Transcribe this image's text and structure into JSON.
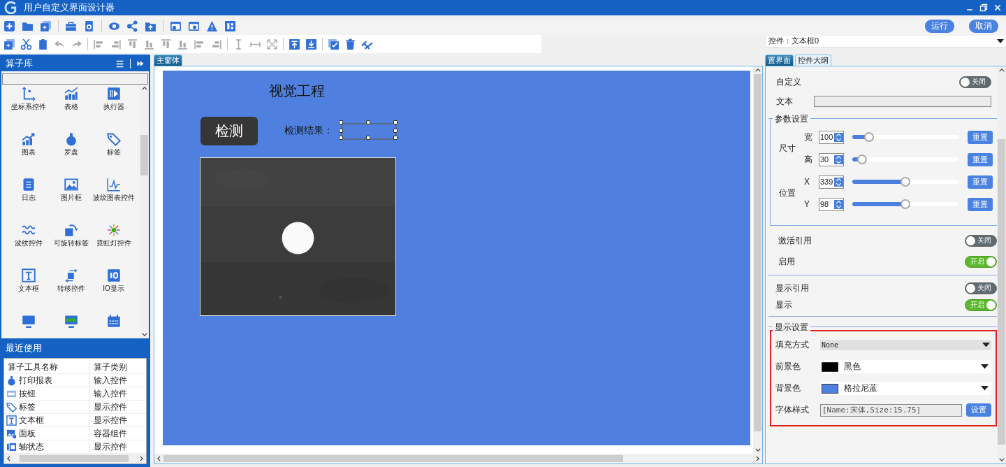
{
  "window": {
    "title": "用户自定义界面设计器"
  },
  "toolbar_main": [
    {
      "disabled": false
    },
    {
      "disabled": false
    },
    {
      "disabled": false
    },
    {
      "disabled": false
    },
    {
      "disabled": false
    },
    {
      "disabled": false
    },
    {
      "disabled": false
    },
    {
      "disabled": false
    },
    {
      "disabled": false
    },
    {
      "disabled": false
    },
    {
      "disabled": false
    },
    {
      "disabled": false
    }
  ],
  "toolbar_edit": [
    {
      "disabled": false
    },
    {
      "disabled": false
    },
    {
      "disabled": false
    },
    {
      "disabled": true
    },
    {
      "disabled": true
    },
    {
      "disabled": true
    },
    {
      "disabled": true
    },
    {
      "disabled": true
    },
    {
      "disabled": true
    },
    {
      "disabled": true
    },
    {
      "disabled": true
    },
    {
      "disabled": true
    },
    {
      "disabled": true
    },
    {
      "disabled": true
    },
    {
      "disabled": true
    },
    {
      "disabled": true
    },
    {
      "disabled": false
    },
    {
      "disabled": false
    },
    {
      "disabled": false
    },
    {
      "disabled": false
    },
    {
      "disabled": false
    }
  ],
  "actions": [
    {
      "label": "运行"
    },
    {
      "label": "取消"
    }
  ],
  "control_selector": {
    "value": "控件：文本框0"
  },
  "library": {
    "title": "算子库",
    "items": [
      {
        "label": "坐标系控件"
      },
      {
        "label": "表格"
      },
      {
        "label": "执行器"
      },
      {
        "label": "图表"
      },
      {
        "label": "罗盘"
      },
      {
        "label": "标签"
      },
      {
        "label": "日志"
      },
      {
        "label": "图片框"
      },
      {
        "label": "波纹图表控件"
      },
      {
        "label": "波纹控件"
      },
      {
        "label": "可旋转标签"
      },
      {
        "label": "霓虹灯控件"
      },
      {
        "label": "文本框"
      },
      {
        "label": "转移控件"
      },
      {
        "label": "IO显示"
      }
    ]
  },
  "recent": {
    "title": "最近使用",
    "columns": [
      "算子工具名称",
      "算子类别"
    ],
    "rows": [
      {
        "name": "打印报表",
        "category": "输入控件"
      },
      {
        "name": "按钮",
        "category": "输入控件"
      },
      {
        "name": "标签",
        "category": "显示控件"
      },
      {
        "name": "文本框",
        "category": "显示控件"
      },
      {
        "name": "面板",
        "category": "容器组件"
      },
      {
        "name": "轴状态",
        "category": "显示控件"
      }
    ]
  },
  "canvas": {
    "tab": "主窗体",
    "title": "视觉工程",
    "button": "检测",
    "result_label": "检测结果：",
    "result_box": {
      "selected": true
    }
  },
  "properties": {
    "tabs": [
      {
        "label": "置界面",
        "selected": true
      },
      {
        "label": "控件大纲",
        "selected": false
      }
    ],
    "custom": {
      "label": "自定义",
      "on": false,
      "state_text": "关闭"
    },
    "text": {
      "label": "文本"
    },
    "params": {
      "title": "参数设置",
      "groups": [
        {
          "label": "尺寸",
          "rows": [
            {
              "label": "宽",
              "value": "100",
              "level": 0.16,
              "reset": "重置"
            },
            {
              "label": "高",
              "value": "30",
              "level": 0.09,
              "reset": "重置"
            }
          ]
        },
        {
          "label": "位置",
          "rows": [
            {
              "label": "X",
              "value": "339",
              "level": 0.5,
              "reset": "重置"
            },
            {
              "label": "Y",
              "value": "98",
              "level": 0.5,
              "reset": "重置"
            }
          ]
        }
      ]
    },
    "switch_sections": [
      {
        "switches": [
          {
            "label": "激活引用",
            "on": false,
            "state_text": "关闭"
          },
          {
            "label": "启用",
            "on": true,
            "state_text": "开启"
          }
        ]
      },
      {
        "switches": [
          {
            "label": "显示引用",
            "on": false,
            "state_text": "关闭"
          },
          {
            "label": "显示",
            "on": true,
            "state_text": "开启"
          }
        ]
      }
    ],
    "display": {
      "title": "显示设置",
      "highlighted": true,
      "fill_mode": {
        "label": "填充方式",
        "value": "None"
      },
      "colors": [
        {
          "label": "前景色",
          "color": "#000000",
          "value": "黑色"
        },
        {
          "label": "背景色",
          "color": "#4f80df",
          "value": "格拉尼蓝"
        }
      ],
      "font": {
        "label": "字体样式",
        "value": "[Name:宋体,Size:15.75]",
        "button": "设置"
      }
    }
  }
}
